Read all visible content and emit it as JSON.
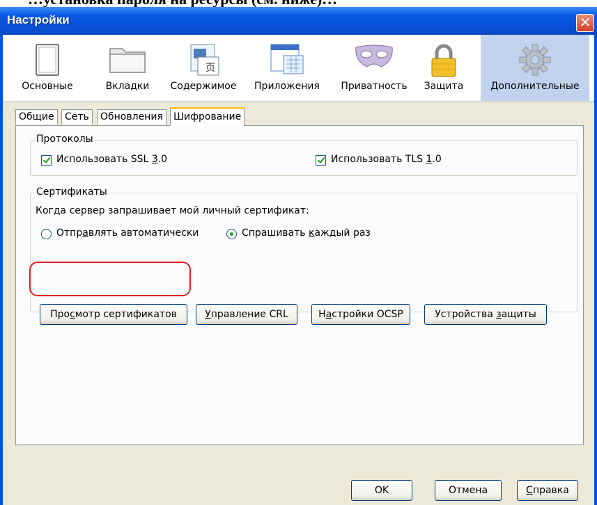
{
  "page_caption": "…установка пароля на ресурсы (см. ниже)…",
  "window": {
    "title": "Настройки",
    "close_glyph": "✕"
  },
  "panes": [
    {
      "label": "Основные",
      "icon": "window-icon"
    },
    {
      "label": "Вкладки",
      "icon": "folder-tabs-icon"
    },
    {
      "label": "Содержимое",
      "icon": "content-icon"
    },
    {
      "label": "Приложения",
      "icon": "applications-icon"
    },
    {
      "label": "Приватность",
      "icon": "mask-icon"
    },
    {
      "label": "Защита",
      "icon": "lock-icon"
    },
    {
      "label": "Дополнительные",
      "icon": "gear-icon",
      "selected": true
    }
  ],
  "tabs": [
    {
      "label": "Общие"
    },
    {
      "label": "Сеть"
    },
    {
      "label": "Обновления"
    },
    {
      "label": "Шифрование",
      "active": true
    }
  ],
  "protocols": {
    "legend": "Протоколы",
    "ssl": {
      "pre": "Использовать SSL ",
      "key": "3",
      "post": ".0",
      "checked": true
    },
    "tls": {
      "pre": "Использовать TLS ",
      "key": "1",
      "post": ".0",
      "checked": true
    }
  },
  "certificates": {
    "legend": "Сертификаты",
    "prompt": "Когда сервер запрашивает мой личный сертификат:",
    "radio_auto": {
      "pre": "Отпр",
      "key": "а",
      "post": "влять автоматически",
      "selected": false
    },
    "radio_ask": {
      "pre": "Спрашивать ",
      "key": "к",
      "post": "аждый раз",
      "selected": true
    },
    "buttons": {
      "view": {
        "pre": "Про",
        "key": "с",
        "post": "мотр сертификатов"
      },
      "crl": {
        "pre": "",
        "key": "У",
        "post": "правление CRL"
      },
      "ocsp": {
        "pre": "Н",
        "key": "а",
        "post": "стройки OCSP"
      },
      "devices": {
        "pre": "Устройства ",
        "key": "з",
        "post": "ащиты"
      }
    }
  },
  "footer": {
    "ok": "OK",
    "cancel": "Отмена",
    "help": {
      "pre": "",
      "key": "С",
      "post": "правка"
    }
  },
  "colors": {
    "title_bar": "#0858e6",
    "selected_pane": "#c1d2ee",
    "highlight_ring": "#e02020",
    "check_mark": "#21a121",
    "dialog_face": "#ece9d8"
  }
}
